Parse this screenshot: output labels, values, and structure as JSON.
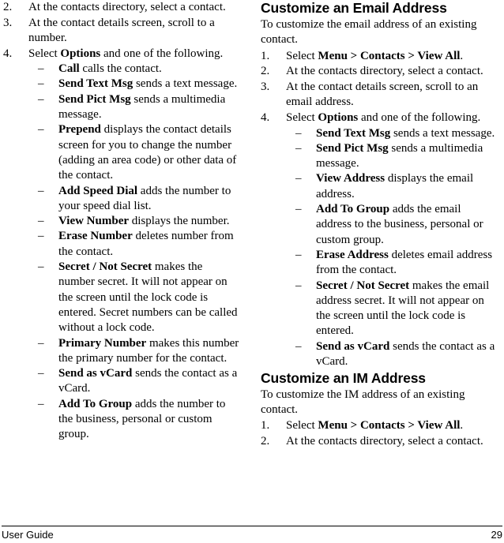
{
  "page": {
    "footer_left": "User Guide",
    "footer_right": "29"
  },
  "left_column": {
    "continued_steps": [
      {
        "num": "2.",
        "text": "At the contacts directory, select a contact."
      },
      {
        "num": "3.",
        "text": "At the contact details screen, scroll to a number."
      },
      {
        "num": "4.",
        "lead_plain_1": "Select ",
        "lead_bold": "Options",
        "lead_plain_2": " and one of the following.",
        "options": [
          {
            "dash": "–",
            "term": "Call",
            "desc": " calls the contact."
          },
          {
            "dash": "–",
            "term": "Send Text Msg",
            "desc": " sends a text message."
          },
          {
            "dash": "–",
            "term": "Send Pict Msg",
            "desc": " sends a multimedia message."
          },
          {
            "dash": "–",
            "term": "Prepend",
            "desc": " displays the contact details screen for you to change the number (adding an area code) or other data of the contact."
          },
          {
            "dash": "–",
            "term": "Add Speed Dial",
            "desc": " adds the number to your speed dial list."
          },
          {
            "dash": "–",
            "term": "View Number",
            "desc": " displays the number."
          },
          {
            "dash": "–",
            "term": "Erase Number",
            "desc": " deletes number from the contact."
          },
          {
            "dash": "–",
            "term": "Secret / Not Secret",
            "desc": " makes the number secret. It will not appear on the screen until the lock code is entered. Secret numbers can be called without a lock code."
          },
          {
            "dash": "–",
            "term": "Primary Number",
            "desc": " makes this number the primary number for the contact."
          },
          {
            "dash": "–",
            "term": "Send as vCard",
            "desc": " sends the contact as a vCard."
          },
          {
            "dash": "–",
            "term": "Add To Group",
            "desc": " adds the number to the business, personal or custom group."
          }
        ]
      }
    ]
  },
  "right_column": {
    "email_section": {
      "heading": "Customize an Email Address",
      "intro": "To customize the email address of an existing contact.",
      "steps": [
        {
          "num": "1.",
          "lead_plain_1": "Select ",
          "lead_bold": "Menu > Contacts > View All",
          "lead_plain_2": "."
        },
        {
          "num": "2.",
          "text": "At the contacts directory, select a contact."
        },
        {
          "num": "3.",
          "text": "At the contact details screen, scroll to an email address."
        },
        {
          "num": "4.",
          "lead_plain_1": "Select ",
          "lead_bold": "Options",
          "lead_plain_2": " and one of the following.",
          "options": [
            {
              "dash": "–",
              "term": "Send Text Msg",
              "desc": " sends a text message."
            },
            {
              "dash": "–",
              "term": "Send Pict Msg",
              "desc": " sends a multimedia message."
            },
            {
              "dash": "–",
              "term": "View Address",
              "desc": " displays the email address."
            },
            {
              "dash": "–",
              "term": "Add To Group",
              "desc": " adds the email address to the business, personal or custom group."
            },
            {
              "dash": "–",
              "term": "Erase Address",
              "desc": " deletes email address from the contact."
            },
            {
              "dash": "–",
              "term": "Secret / Not Secret",
              "desc": " makes the email address secret. It will not appear on the screen until the lock code is entered."
            },
            {
              "dash": "–",
              "term": "Send as vCard",
              "desc": " sends the contact as a vCard."
            }
          ]
        }
      ]
    },
    "im_section": {
      "heading": "Customize an IM Address",
      "intro": "To customize the IM address of an existing contact.",
      "steps": [
        {
          "num": "1.",
          "lead_plain_1": "Select ",
          "lead_bold": "Menu > Contacts > View All",
          "lead_plain_2": "."
        },
        {
          "num": "2.",
          "text": "At the contacts directory, select a contact."
        }
      ]
    }
  }
}
